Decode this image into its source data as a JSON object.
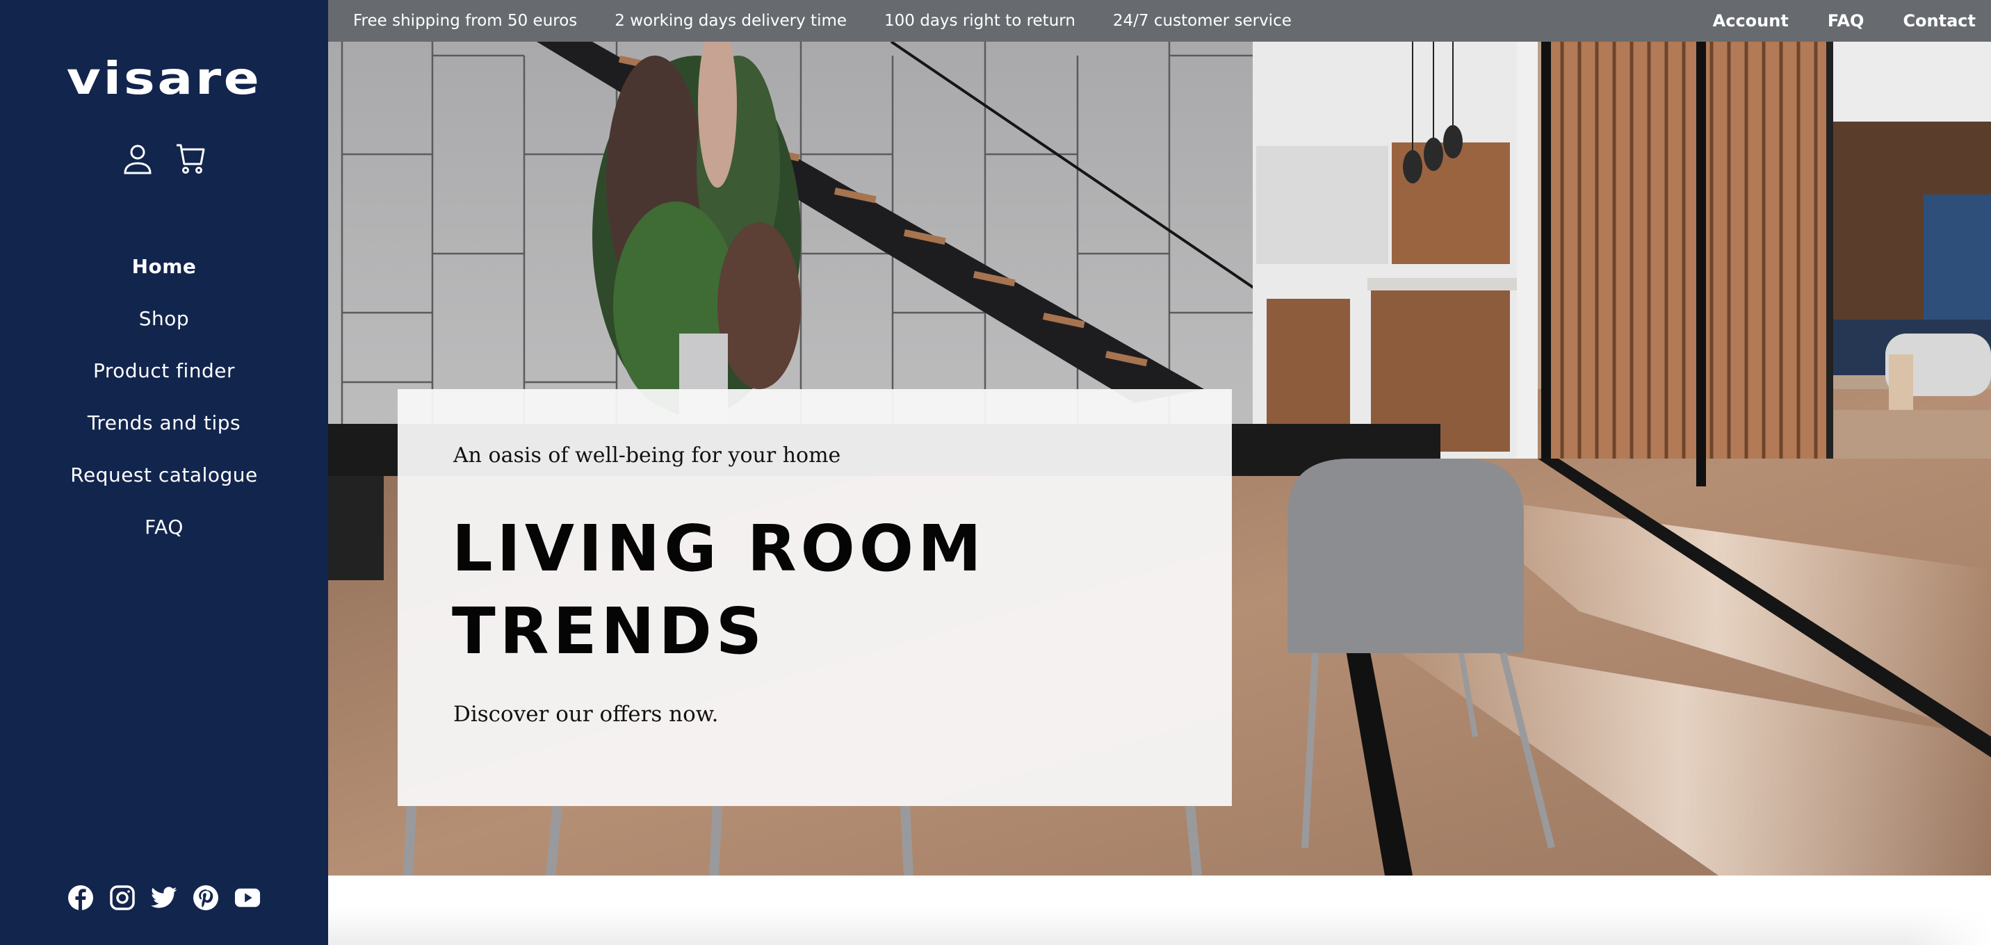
{
  "brand": {
    "logo_text": "visare",
    "sidebar_color": "#12254d",
    "topbar_color": "#676b6f"
  },
  "header_icons": [
    {
      "name": "account",
      "icon": "user-icon"
    },
    {
      "name": "cart",
      "icon": "cart-icon"
    }
  ],
  "sidebar": {
    "nav": [
      {
        "label": "Home",
        "active": true
      },
      {
        "label": "Shop",
        "active": false
      },
      {
        "label": "Product finder",
        "active": false
      },
      {
        "label": "Trends and tips",
        "active": false
      },
      {
        "label": "Request catalogue",
        "active": false
      },
      {
        "label": "FAQ",
        "active": false
      }
    ],
    "social": [
      {
        "name": "Facebook",
        "icon": "facebook-icon"
      },
      {
        "name": "Instagram",
        "icon": "instagram-icon"
      },
      {
        "name": "Twitter",
        "icon": "twitter-icon"
      },
      {
        "name": "Pinterest",
        "icon": "pinterest-icon"
      },
      {
        "name": "YouTube",
        "icon": "youtube-icon"
      }
    ]
  },
  "topbar": {
    "usps": [
      "Free shipping from 50 euros",
      "2 working days delivery time",
      "100 days right to return",
      "24/7 customer service"
    ],
    "links": [
      "Account",
      "FAQ",
      "Contact"
    ]
  },
  "hero": {
    "image_description": "modern interior with concrete wall, black steel staircase, plant arrangement, kitchen, wooden slat wall, dining table and grey chair",
    "subtitle": "An oasis of well-being for your home",
    "title_line1": "LIVING ROOM",
    "title_line2": "TRENDS",
    "cta": "Discover our offers now."
  }
}
